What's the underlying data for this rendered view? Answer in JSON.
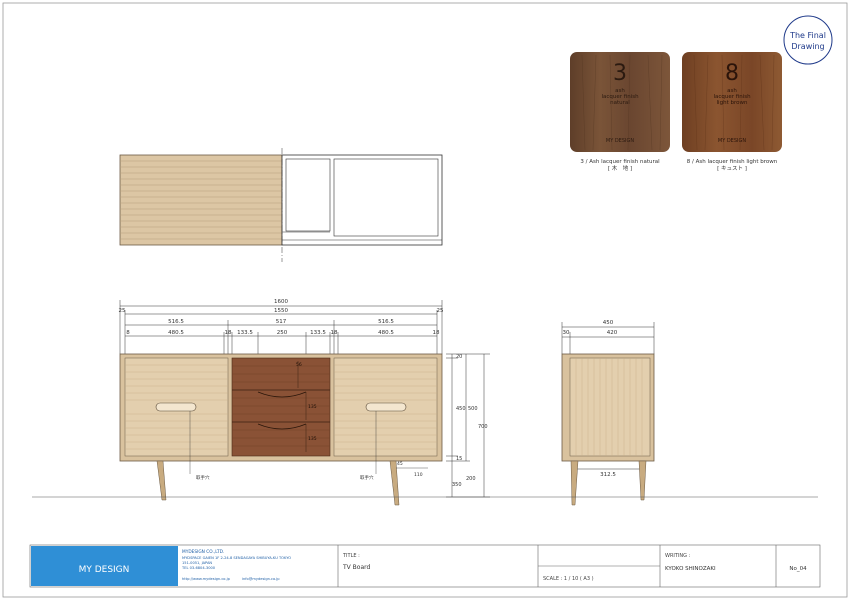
{
  "stamp": {
    "line1": "The Final",
    "line2": "Drawing"
  },
  "samples": [
    {
      "number": "3",
      "lines": [
        "ash",
        "lacquer finish",
        "natural"
      ],
      "brand": "MY DESIGN",
      "caption": "3 / Ash lacquer finish natural",
      "caption2": "[ 木　地 ]",
      "color": "#6e4a31"
    },
    {
      "number": "8",
      "lines": [
        "ash",
        "lacquer finish",
        "light brown"
      ],
      "brand": "MY DESIGN",
      "caption": "8 / Ash lacquer finish light brown",
      "caption2": "[ キュスト ]",
      "color": "#7a4a2b"
    }
  ],
  "dims_front": {
    "total_width": "1600",
    "edge_left": "25",
    "inner_width": "1550",
    "edge_right": "25",
    "sections": [
      "516.5",
      "517",
      "516.5"
    ],
    "edge_l2": "8",
    "sub_l": "480.5",
    "gap_l": "18",
    "mid_l": "133.5",
    "mid_c": "250",
    "mid_r": "133.5",
    "gap_r": "18",
    "sub_r": "480.5",
    "edge_r2": "18",
    "right_top": "20",
    "right_a": "450",
    "right_b": "500",
    "right_h": "700",
    "right_c": "15",
    "right_leg": "200",
    "leg_note": "45",
    "leg_note2": "110",
    "leg_h": "350",
    "handle_left": "取手穴",
    "handle_right": "取手穴",
    "drawer_h1": "56",
    "drawer_h2": "135",
    "drawer_h3": "135"
  },
  "dims_side": {
    "depth": "450",
    "edge": "30",
    "inner": "420",
    "leg_span": "312.5"
  },
  "titleblock": {
    "company": "MYDESIGN CO.,LTD.",
    "address1": "MYDSPACE GAIEN 1F 2-24-8 SENDAGAYA SHIBUYA-KU TOKYO",
    "address2": "151-0051, JAPAN",
    "tel": "TEL 03-6804-3000",
    "web": "http://www.mydesign.co.jp",
    "email": "info@mydesign.co.jp",
    "logo": "MY DESIGN",
    "title_label": "TITLE :",
    "title_value": "TV Board",
    "scale": "SCALE : 1 / 10 ( A3 )",
    "writing_label": "WRITING :",
    "writing_value": "KYOKO SHINOZAKI",
    "number": "No_04",
    "logo_color": "#2f8fd6"
  }
}
